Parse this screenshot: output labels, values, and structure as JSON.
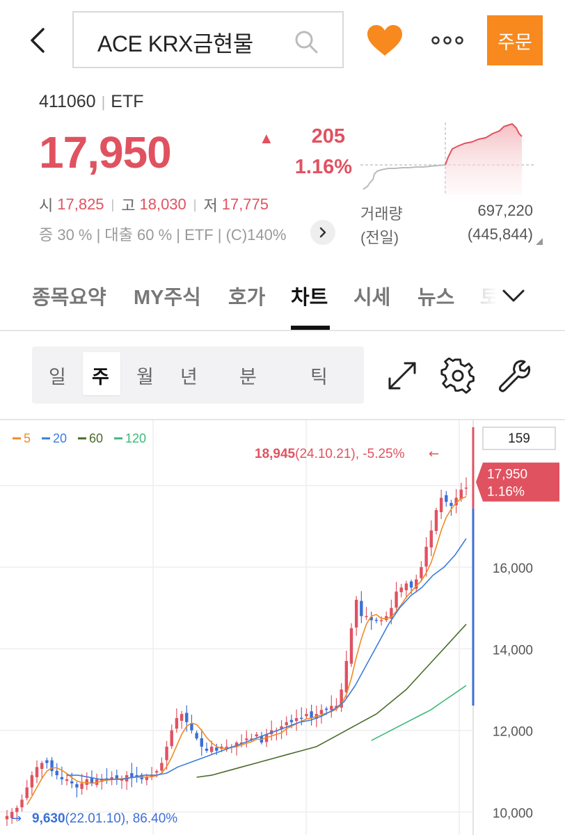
{
  "header": {
    "search_text": "ACE KRX금현물",
    "order_label": "주문",
    "icons": {
      "back": "back-arrow-icon",
      "search": "search-icon",
      "favorite": "heart-icon",
      "more": "more-dots-icon"
    },
    "favorite_color": "#f7891e"
  },
  "stock": {
    "code": "411060",
    "type": "ETF",
    "price": "17,950",
    "change_arrow": "▲",
    "change_amount": "205",
    "change_percent": "1.16%",
    "open_label": "시",
    "open": "17,825",
    "high_label": "고",
    "high": "18,030",
    "low_label": "저",
    "low": "17,775",
    "info_line": "증 30 % | 대출 60 % | ETF | (C)140%",
    "volume_label": "거래량",
    "prev_label": "(전일)",
    "volume": "697,220",
    "prev_volume": "(445,844)",
    "up_color": "#e05260"
  },
  "tabs": [
    {
      "label": "종목요약"
    },
    {
      "label": "MY주식"
    },
    {
      "label": "호가"
    },
    {
      "label": "차트"
    },
    {
      "label": "시세"
    },
    {
      "label": "뉴스"
    },
    {
      "label": "토"
    }
  ],
  "active_tab": "차트",
  "periods": [
    "일",
    "주",
    "월",
    "년",
    "분",
    "틱"
  ],
  "active_period": "주",
  "chart_data": {
    "type": "candlestick",
    "interval": "weekly",
    "legend": [
      {
        "name": "5",
        "color": "#f08a24"
      },
      {
        "name": "20",
        "color": "#3b7ddd"
      },
      {
        "name": "60",
        "color": "#4a6b2a"
      },
      {
        "name": "120",
        "color": "#3cb878"
      }
    ],
    "y_ticks": [
      "16,000",
      "14,000",
      "12,000",
      "10,000"
    ],
    "y_range": [
      9400,
      19600
    ],
    "count_badge": "159",
    "current_price": "17,950",
    "current_change": "1.16%",
    "high_annotation": {
      "value": "18,945",
      "text": "(24.10.21), -5.25%"
    },
    "low_annotation": {
      "value": "9,630",
      "text": "(22.01.10), 86.40%"
    },
    "close_series": [
      9900,
      10000,
      10100,
      10300,
      10600,
      10900,
      11100,
      11200,
      11200,
      11000,
      10900,
      10800,
      10800,
      10700,
      10600,
      10700,
      10800,
      10700,
      10800,
      10800,
      10800,
      10850,
      10800,
      10800,
      10900,
      10850,
      10900,
      10800,
      10850,
      10900,
      11000,
      11200,
      11600,
      12000,
      12300,
      12400,
      12200,
      12000,
      11800,
      11600,
      11500,
      11600,
      11500,
      11600,
      11600,
      11600,
      11700,
      11700,
      11800,
      11800,
      11900,
      11700,
      11900,
      12000,
      12000,
      12100,
      12200,
      12200,
      12300,
      12300,
      12400,
      12300,
      12400,
      12500,
      12500,
      12600,
      12600,
      13000,
      13700,
      14500,
      15200,
      14800,
      14800,
      14700,
      14700,
      14700,
      14800,
      15000,
      15400,
      15500,
      15600,
      15500,
      15700,
      16000,
      16500,
      16900,
      17400,
      17700,
      17600,
      17500,
      17700,
      17900,
      17950
    ],
    "ma20": [
      10900,
      10900,
      10850,
      10800,
      10800,
      10800,
      10850,
      10900,
      10900,
      10950,
      11100,
      11200,
      11300,
      11400,
      11500,
      11600,
      11700,
      11800,
      11900,
      12000,
      12100,
      12200,
      12250,
      12350,
      12500,
      12700,
      13100,
      13600,
      14100,
      14600,
      15000,
      15300,
      15500,
      15800,
      16000,
      16300,
      16700
    ],
    "ma60": [
      10850,
      10900,
      11000,
      11100,
      11200,
      11300,
      11400,
      11500,
      11600,
      11800,
      12000,
      12200,
      12400,
      12700,
      13000,
      13400,
      13800,
      14200,
      14600
    ],
    "ma120": [
      11750,
      11900,
      12050,
      12200,
      12350,
      12500,
      12700,
      12900,
      13100
    ]
  }
}
